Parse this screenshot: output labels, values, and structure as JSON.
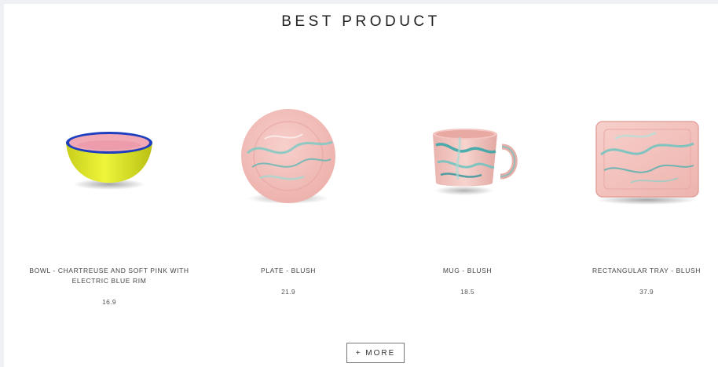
{
  "section": {
    "title": "BEST PRODUCT"
  },
  "products": [
    {
      "name": "BOWL - CHARTREUSE AND SOFT PINK WITH ELECTRIC BLUE RIM",
      "price": "16.9",
      "image_icon": "bowl-image"
    },
    {
      "name": "PLATE - BLUSH",
      "price": "21.9",
      "image_icon": "plate-image"
    },
    {
      "name": "MUG - BLUSH",
      "price": "18.5",
      "image_icon": "mug-image"
    },
    {
      "name": "RECTANGULAR TRAY - BLUSH",
      "price": "37.9",
      "image_icon": "tray-image"
    }
  ],
  "more_button": {
    "label": "+ MORE"
  },
  "colors": {
    "bowl_body": "#e4ec2e",
    "bowl_rim": "#1d3fbf",
    "bowl_inner": "#f2a9b6",
    "blush": "#f3c2c0",
    "marble_teal": "#6cc3c0",
    "page_bg": "#eef0f3"
  }
}
